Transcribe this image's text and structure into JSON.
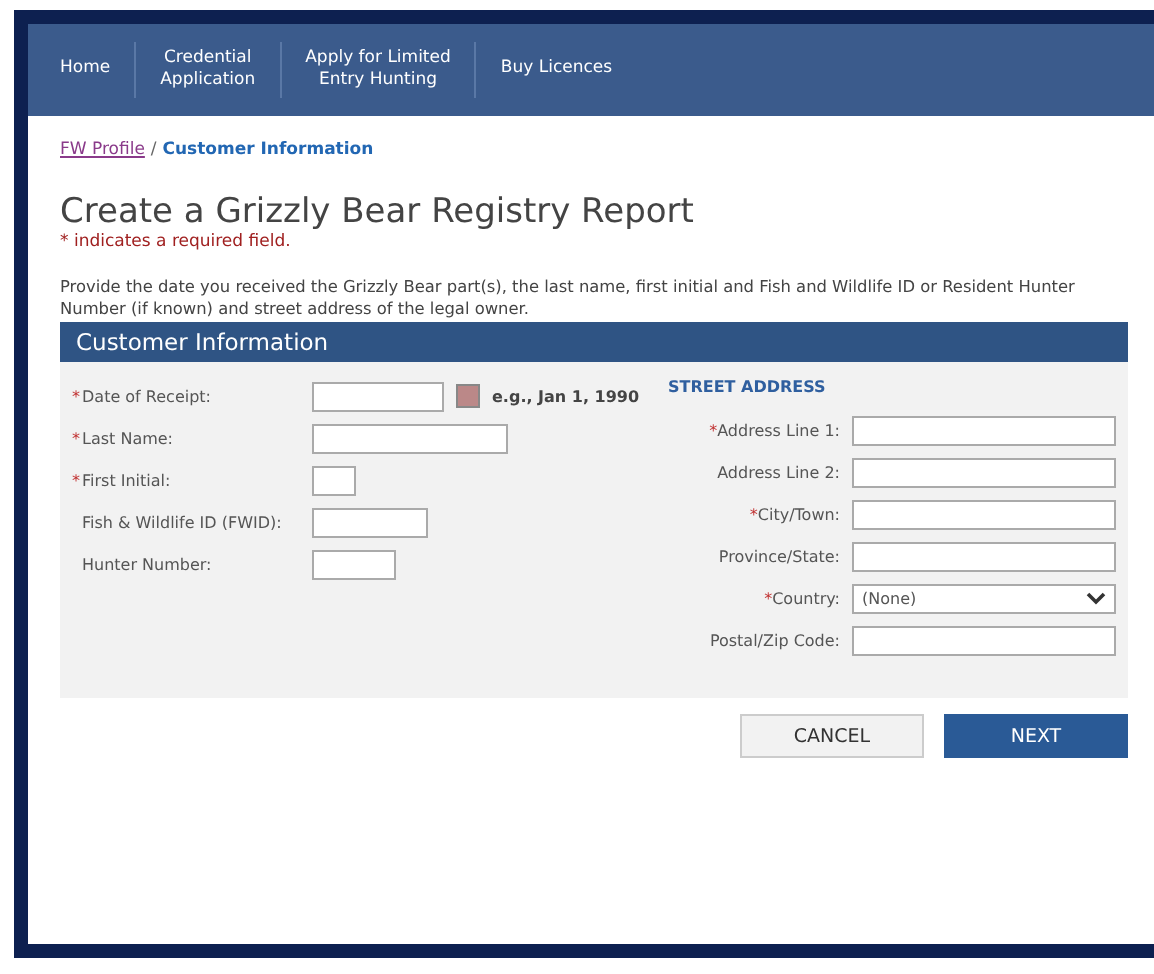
{
  "nav": [
    "Home",
    "Credential\nApplication",
    "Apply for Limited\nEntry Hunting",
    "Buy Licences"
  ],
  "breadcrumb": {
    "link": "FW Profile",
    "separator": "/",
    "current": "Customer Information"
  },
  "title": "Create a Grizzly Bear Registry Report",
  "required_note": "* indicates a required field.",
  "required_marker": "*",
  "intro": "Provide the date you received the Grizzly Bear part(s), the last name, first initial and Fish and Wildlife ID or Resident Hunter Number (if known) and street address of the legal owner.",
  "section_title": "Customer Information",
  "left_fields": [
    {
      "label": "Date of Receipt:",
      "required": true,
      "kind": "date",
      "hint": "e.g., Jan 1, 1990"
    },
    {
      "label": "Last Name:",
      "required": true,
      "kind": "text"
    },
    {
      "label": "First Initial:",
      "required": true,
      "kind": "text"
    },
    {
      "label": "Fish & Wildlife ID (FWID):",
      "required": false,
      "kind": "text"
    },
    {
      "label": "Hunter Number:",
      "required": false,
      "kind": "text"
    }
  ],
  "address_heading": "STREET ADDRESS",
  "right_fields": [
    {
      "label": "Address Line 1:",
      "required": true,
      "kind": "text"
    },
    {
      "label": "Address Line 2:",
      "required": false,
      "kind": "text"
    },
    {
      "label": "City/Town:",
      "required": true,
      "kind": "text"
    },
    {
      "label": "Province/State:",
      "required": false,
      "kind": "text"
    },
    {
      "label": "Country:",
      "required": true,
      "kind": "select",
      "value": "(None)"
    },
    {
      "label": "Postal/Zip Code:",
      "required": false,
      "kind": "text"
    }
  ],
  "buttons": [
    "CANCEL",
    "NEXT"
  ]
}
